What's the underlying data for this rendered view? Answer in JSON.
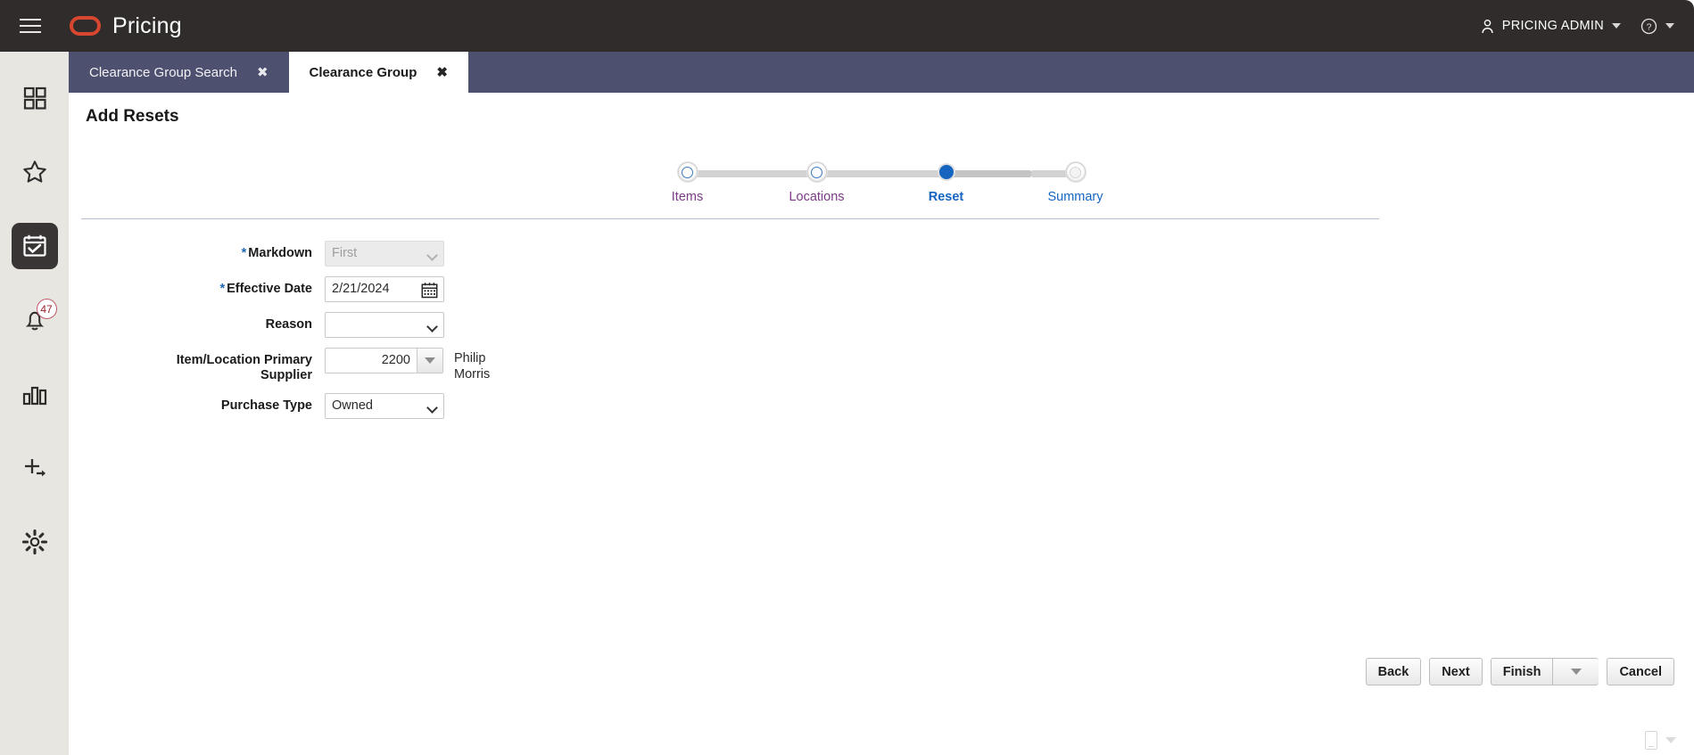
{
  "header": {
    "menu_icon": "hamburger-icon",
    "brand_name": "Pricing",
    "brand_color": "#d7462e",
    "user_label": "PRICING ADMIN",
    "user_icon": "person-icon",
    "help_icon": "help-circle-icon"
  },
  "sidebar": {
    "items": [
      {
        "name": "dashboard",
        "icon": "grid-icon",
        "active": false,
        "badge": ""
      },
      {
        "name": "favorites",
        "icon": "star-icon",
        "active": false,
        "badge": ""
      },
      {
        "name": "tasks",
        "icon": "calendar-check-icon",
        "active": true,
        "badge": ""
      },
      {
        "name": "notifications",
        "icon": "bell-icon",
        "active": false,
        "badge": "47"
      },
      {
        "name": "reports",
        "icon": "bar-chart-icon",
        "active": false,
        "badge": ""
      },
      {
        "name": "quick-create",
        "icon": "plus-arrow-icon",
        "active": false,
        "badge": ""
      },
      {
        "name": "settings",
        "icon": "gear-icon",
        "active": false,
        "badge": ""
      }
    ]
  },
  "tabs": [
    {
      "label": "Clearance Group Search",
      "active": false,
      "close": "✖"
    },
    {
      "label": "Clearance Group",
      "active": true,
      "close": "✖"
    }
  ],
  "page": {
    "title": "Add Resets"
  },
  "stepper": {
    "steps": [
      {
        "label": "Items",
        "state": "visited"
      },
      {
        "label": "Locations",
        "state": "visited"
      },
      {
        "label": "Reset",
        "state": "current"
      },
      {
        "label": "Summary",
        "state": "future"
      }
    ],
    "current_color": "#1565c0",
    "visited_color": "#7b3a86"
  },
  "form": {
    "markdown": {
      "label": "Markdown",
      "required": true,
      "value": "First",
      "disabled": true
    },
    "effective_date": {
      "label": "Effective Date",
      "required": true,
      "value": "2/21/2024",
      "icon": "calendar-icon"
    },
    "reason": {
      "label": "Reason",
      "required": false,
      "value": ""
    },
    "supplier": {
      "label": "Item/Location Primary Supplier",
      "label_line1": "Item/Location Primary",
      "label_line2": "Supplier",
      "required": false,
      "value": "2200",
      "display_name": "Philip Morris",
      "lov_icon": "dropdown-triangle-icon"
    },
    "purchase_type": {
      "label": "Purchase Type",
      "required": false,
      "value": "Owned"
    }
  },
  "footer": {
    "back": "Back",
    "next": "Next",
    "finish": "Finish",
    "finish_menu_icon": "dropdown-triangle-icon",
    "cancel": "Cancel"
  },
  "corner": {
    "device_icon": "mobile-device-icon",
    "caret_icon": "dropdown-triangle-icon"
  }
}
